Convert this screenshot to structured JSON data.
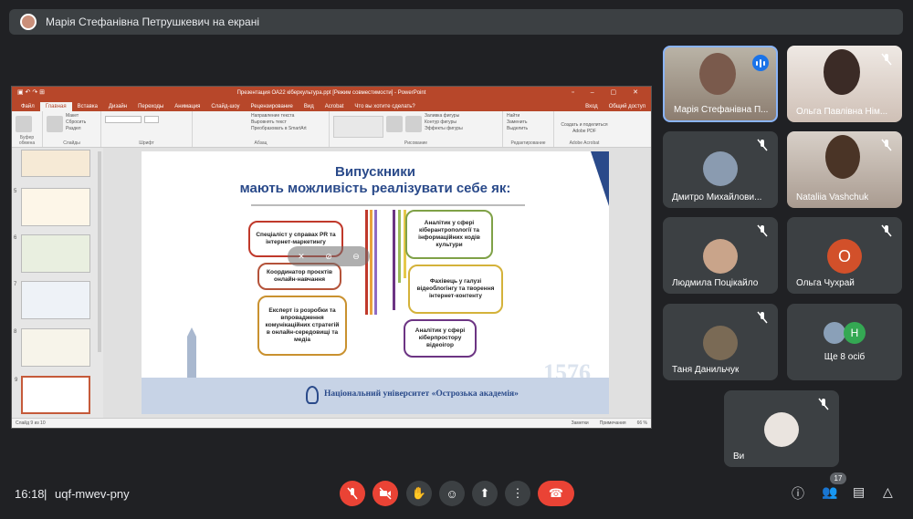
{
  "presenter_bar": {
    "text": "Марія Стефанівна Петрушкевич на екрані"
  },
  "powerpoint": {
    "title": "Презентация ОА22 кіберкультура.ppt [Режим совместимости] - PowerPoint",
    "tabs": [
      "Файл",
      "Главная",
      "Вставка",
      "Дизайн",
      "Переходы",
      "Анимация",
      "Слайд-шоу",
      "Рецензирование",
      "Вид",
      "Acrobat",
      "Что вы хотите сделать?"
    ],
    "right_tabs": [
      "Вход",
      "Общий доступ"
    ],
    "ribbon_groups": [
      "Буфер обмена",
      "Слайды",
      "Шрифт",
      "Абзац",
      "Рисование",
      "Редактирование",
      "Adobe Acrobat"
    ],
    "ribbon_items": {
      "paste": "Вставить",
      "create_slide": "Создать слайд",
      "layout": "Макет",
      "reset": "Сбросить",
      "section": "Раздел",
      "text_direction": "Направление текста",
      "align_text": "Выровнять текст",
      "smartart": "Преобразовать в SmartArt",
      "arrange": "Упорядочить",
      "quick_styles": "Экспресс-стили",
      "fill": "Заливка фигуры",
      "outline": "Контур фигуры",
      "effects": "Эффекты фигуры",
      "find": "Найти",
      "replace": "Заменить",
      "select": "Выделить",
      "adobe": "Создать и поделиться Adobe PDF"
    },
    "thumb_numbers": [
      "5",
      "6",
      "7",
      "8",
      "9"
    ],
    "status_left": "Слайд 9 из 10",
    "status_notes": "Заметки",
    "status_comments": "Примечания",
    "zoom": "66 %"
  },
  "slide": {
    "title_line1": "Випускники",
    "title_line2": "мають можливість реалізувати себе як:",
    "left_items": [
      "Спеціаліст у справах PR та інтернет-маркетингу",
      "Координатор проєктів онлайн-навчання",
      "Експерт із розробки та впровадження комунікаційних стратегій в онлайн-середовищі та медіа"
    ],
    "right_items": [
      "Аналітик у сфері кіберантропології та інформаційних кодів культури",
      "Фахівець у галузі відеоблогінгу та творення інтернет-контенту",
      "Аналітик у сфері кіберпростору відеоігор"
    ],
    "year": "1576",
    "footer": "Національний університет «Острозька академія»"
  },
  "participants": [
    {
      "name": "Марія Стефанівна П...",
      "type": "video"
    },
    {
      "name": "Ольга Павлівна Нім...",
      "type": "video"
    },
    {
      "name": "Дмитро Михайлови...",
      "type": "avatar"
    },
    {
      "name": "Nataliia Vashchuk",
      "type": "video"
    },
    {
      "name": "Людмила Поцікайло",
      "type": "avatar"
    },
    {
      "name": "Ольга Чухрай",
      "type": "initial",
      "initial": "О"
    },
    {
      "name": "Таня Данильчук",
      "type": "avatar"
    },
    {
      "name": "Ще 8 осіб",
      "type": "group",
      "initial": "Н"
    },
    {
      "name": "Ви",
      "type": "avatar"
    }
  ],
  "bottom": {
    "time": "16:18",
    "separator": "|",
    "meeting_code": "uqf-mwev-pny",
    "participant_count": "17"
  },
  "colors": {
    "accent": "#8ab4f8",
    "danger": "#ea4335",
    "bg": "#202124",
    "tile": "#3c4043"
  }
}
